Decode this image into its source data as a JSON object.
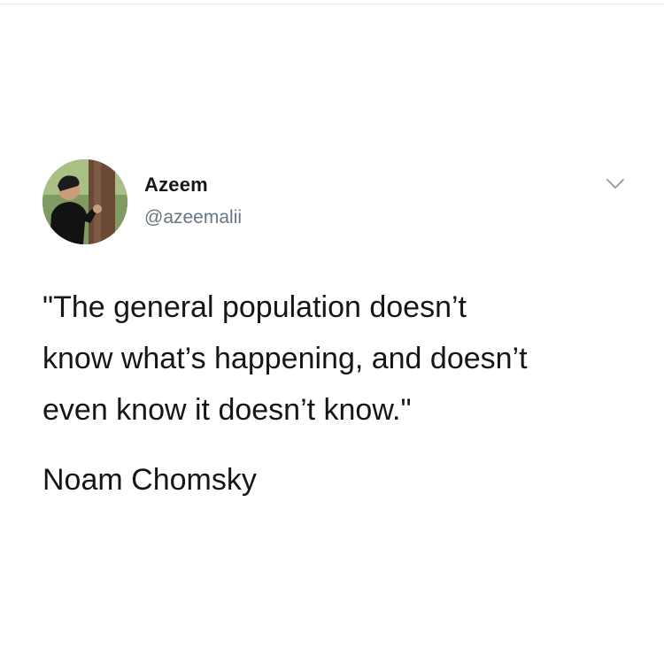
{
  "tweet": {
    "author": {
      "display_name": "Azeem",
      "handle": "@azeemalii",
      "avatar_icon": "profile-photo"
    },
    "menu_icon": "chevron-down-icon",
    "text_lines": [
      "\"The general population doesn’t",
      "know what’s happening, and doesn’t",
      "even know it doesn’t know.\""
    ],
    "attribution": "Noam Chomsky"
  },
  "colors": {
    "background": "#ffffff",
    "text_primary": "#14171a",
    "text_secondary": "#657786",
    "chevron": "#8899a6"
  }
}
